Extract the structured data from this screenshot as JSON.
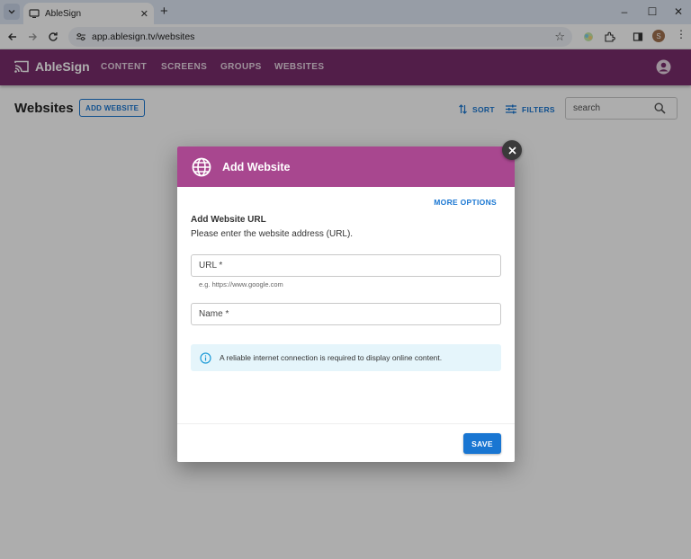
{
  "browser": {
    "tab_title": "AbleSign",
    "url": "app.ablesign.tv/websites",
    "profile_initial": "S"
  },
  "app": {
    "brand": "AbleSign",
    "nav": [
      "CONTENT",
      "SCREENS",
      "GROUPS",
      "WEBSITES"
    ]
  },
  "page": {
    "title": "Websites",
    "add_button": "ADD WEBSITE",
    "sort_label": "SORT",
    "filters_label": "FILTERS",
    "search_placeholder": "search"
  },
  "dialog": {
    "title": "Add Website",
    "more_options": "MORE OPTIONS",
    "section_title": "Add Website URL",
    "section_desc": "Please enter the website address (URL).",
    "url_label": "URL *",
    "url_helper": "e.g. https://www.google.com",
    "name_label": "Name *",
    "info_text": "A reliable internet connection is required to display online content.",
    "save_label": "SAVE"
  },
  "colors": {
    "appbar": "#7a2d6c",
    "dialog_header": "#a8478f",
    "primary": "#1976d2",
    "info_bg": "#e5f5fb"
  }
}
